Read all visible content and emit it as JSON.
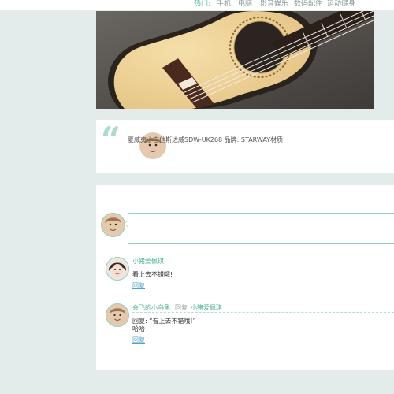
{
  "nav": {
    "hot_label": "热门:",
    "items": [
      "手机",
      "电脑",
      "影音娱乐",
      "数码配件",
      "运动健身"
    ]
  },
  "hero": {
    "subject": "ukulele-photo"
  },
  "quote": {
    "text": "夏威夷小吉他斯达威SDW-UK268 品牌: STARWAY材质"
  },
  "comment_input": {
    "placeholder": ""
  },
  "comments": [
    {
      "user": "小猪爱佩琪",
      "reply_word": "",
      "reply_to": "",
      "body_lines": [
        "看上去不错哦!"
      ],
      "reply_link": "回复"
    },
    {
      "user": "会飞的小乌龟",
      "reply_word": "回复",
      "reply_to": "小猪爱佩琪",
      "body_lines": [
        "回复: “看上去不错哦!”",
        "哈哈"
      ],
      "reply_link": "回复"
    }
  ],
  "colors": {
    "accent": "#41b58c",
    "page_bg": "#e3eceb",
    "quote_mark": "#a9dccd",
    "link": "#4aa6c5"
  }
}
